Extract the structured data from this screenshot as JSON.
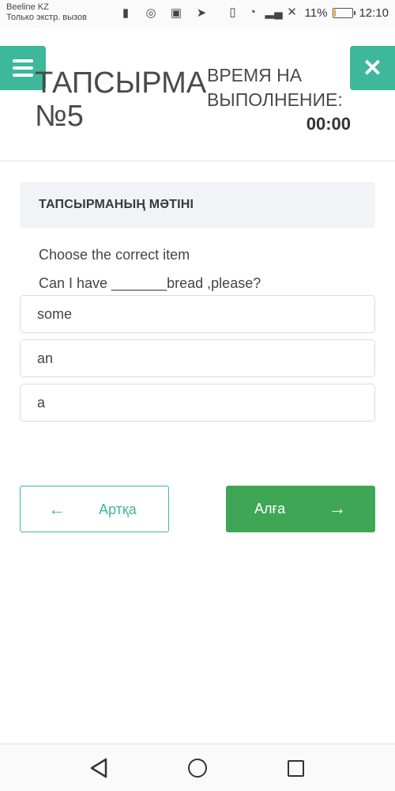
{
  "status_bar": {
    "carrier_line1": "Beeline KZ",
    "carrier_line2": "Только экстр. вызов",
    "icons_left": [
      "sim-icon",
      "sync-icon",
      "image-icon",
      "send-icon"
    ],
    "icons_right": [
      "vibrate-icon",
      "wifi-icon",
      "signal-icon",
      "signal-off-icon"
    ],
    "battery_percent": "11%",
    "battery_level": 0.11,
    "time": "12:10"
  },
  "header": {
    "task_title": "ТАПСЫРМА №5",
    "time_label": "ВРЕМЯ НА ВЫПОЛНЕНИЕ:",
    "time_value": "00:00"
  },
  "task": {
    "heading": "ТАПСЫРМАНЫҢ МӘТІНІ",
    "instruction": "Choose the correct item",
    "question": "Can I have _______bread ,please?",
    "options": [
      "some",
      "an",
      "a"
    ]
  },
  "navigation": {
    "back_label": "Артқа",
    "next_label": "Алға"
  },
  "colors": {
    "accent": "#3db89b",
    "next_button": "#3fa655"
  }
}
